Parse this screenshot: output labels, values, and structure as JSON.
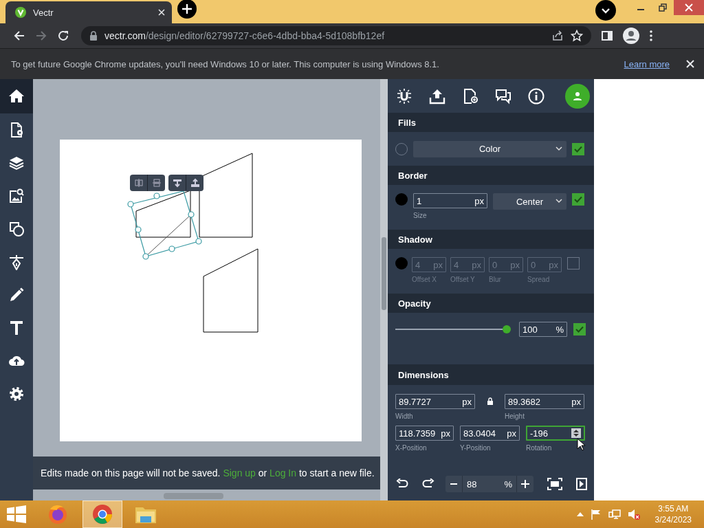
{
  "browser": {
    "tab": {
      "title": "Vectr"
    },
    "url": "vectr.com/design/editor/62799727-c6e6-4dbd-bba4-5d108bfb12ef",
    "forward_disabled": true
  },
  "infobar": {
    "message": "To get future Google Chrome updates, you'll need Windows 10 or later. This computer is using Windows 8.1.",
    "link": "Learn more"
  },
  "sidebar": {
    "items": [
      {
        "kind": "home",
        "selected": true
      },
      {
        "kind": "document-settings",
        "selected": false
      },
      {
        "kind": "layers",
        "selected": false
      },
      {
        "kind": "image-search",
        "selected": false
      },
      {
        "kind": "shapes",
        "selected": false
      },
      {
        "kind": "pen",
        "selected": false
      },
      {
        "kind": "pencil",
        "selected": false
      },
      {
        "kind": "text",
        "selected": false
      },
      {
        "kind": "cloud-upload",
        "selected": false
      },
      {
        "kind": "settings",
        "selected": false
      }
    ]
  },
  "panel": {
    "toolbar": [
      {
        "kind": "magnet"
      },
      {
        "kind": "upload"
      },
      {
        "kind": "new-file"
      },
      {
        "kind": "chat"
      },
      {
        "kind": "info"
      },
      {
        "kind": "account"
      }
    ],
    "fills": {
      "title": "Fills",
      "dropdown": "Color",
      "checked": true
    },
    "border": {
      "title": "Border",
      "color": "#000000",
      "size": {
        "value": "1",
        "unit": "px",
        "label": "Size"
      },
      "dropdown": "Center",
      "checked": true
    },
    "shadow": {
      "title": "Shadow",
      "color": "#000000",
      "checked": false,
      "fields": [
        {
          "value": "4",
          "unit": "px",
          "label": "Offset X"
        },
        {
          "value": "4",
          "unit": "px",
          "label": "Offset Y"
        },
        {
          "value": "0",
          "unit": "px",
          "label": "Blur"
        },
        {
          "value": "0",
          "unit": "px",
          "label": "Spread"
        }
      ]
    },
    "opacity": {
      "title": "Opacity",
      "level": 1,
      "value": "100",
      "unit": "%",
      "checked": true
    },
    "dimensions": {
      "title": "Dimensions",
      "locked": true,
      "width": {
        "value": "89.7727",
        "unit": "px",
        "label": "Width"
      },
      "height": {
        "value": "89.3682",
        "unit": "px",
        "label": "Height"
      },
      "x": {
        "value": "118.7359",
        "unit": "px",
        "label": "X-Position"
      },
      "y": {
        "value": "83.0404",
        "unit": "px",
        "label": "Y-Position"
      },
      "rotation": {
        "value": "-196",
        "label": "Rotation",
        "focused": true
      }
    },
    "zoom": {
      "value": "88",
      "unit": "%"
    }
  },
  "banner": {
    "parts": [
      {
        "kind": "text",
        "text": "Edits made on this page will not be saved."
      },
      {
        "kind": "link",
        "text": "Sign up"
      },
      {
        "kind": "text",
        "text": "or"
      },
      {
        "kind": "link",
        "text": "Log In"
      },
      {
        "kind": "text",
        "text": "to start a new file."
      }
    ]
  },
  "taskbar": {
    "apps": [
      {
        "kind": "start",
        "selected": false
      },
      {
        "kind": "firefox",
        "selected": false
      },
      {
        "kind": "chrome",
        "selected": true
      },
      {
        "kind": "file-explorer",
        "selected": false
      }
    ],
    "time": "3:55 AM",
    "date": "3/24/2023"
  }
}
